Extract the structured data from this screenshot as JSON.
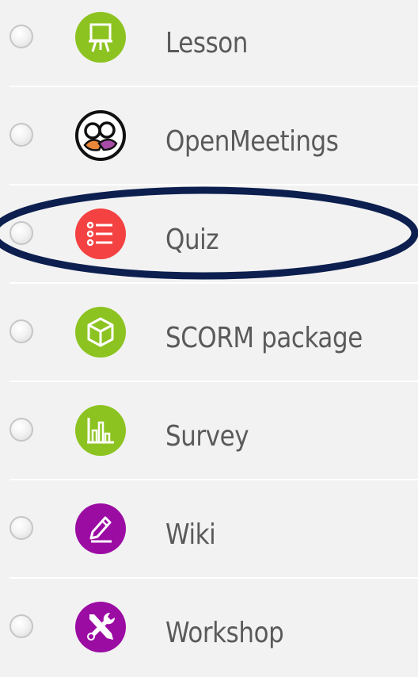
{
  "activities": [
    {
      "label": "Lesson",
      "icon": "lesson-easel-icon",
      "color": "#8cc320"
    },
    {
      "label": "OpenMeetings",
      "icon": "openmeetings-people-icon",
      "color": "#1a1a1a"
    },
    {
      "label": "Quiz",
      "icon": "quiz-list-icon",
      "color": "#f44141"
    },
    {
      "label": "SCORM package",
      "icon": "scorm-cube-icon",
      "color": "#8cc320"
    },
    {
      "label": "Survey",
      "icon": "survey-chart-icon",
      "color": "#8cc320"
    },
    {
      "label": "Wiki",
      "icon": "wiki-pencil-icon",
      "color": "#9b0ca3"
    },
    {
      "label": "Workshop",
      "icon": "workshop-tools-icon",
      "color": "#9b0ca3"
    }
  ],
  "highlight": {
    "item": "Quiz",
    "color": "#0c1f4f"
  }
}
